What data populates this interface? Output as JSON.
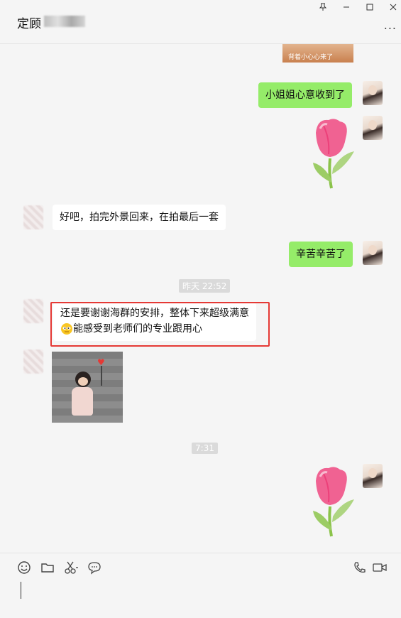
{
  "header": {
    "title": "定顾",
    "pin_icon": "pin-icon",
    "minimize_icon": "minimize-icon",
    "maximize_icon": "maximize-icon",
    "close_icon": "close-icon",
    "more_label": "..."
  },
  "messages": {
    "top_image_caption": "背着小心心来了",
    "msg1": "小姐姐心意收到了",
    "msg2": "好吧，拍完外景回来，在拍最后一套",
    "msg3": "辛苦辛苦了",
    "ts1": "昨天 22:52",
    "msg4_line1": "还是要谢谢海群的安排，整体下来超级满意",
    "msg4_line2": "能感受到老师们的专业跟用心",
    "ts2": "7:31"
  },
  "toolbar": {
    "icons": [
      "emoji-icon",
      "folder-icon",
      "scissors-icon",
      "chat-bubble-icon",
      "phone-icon",
      "video-icon"
    ]
  },
  "colors": {
    "my_bubble": "#95ec69",
    "other_bubble": "#ffffff",
    "highlight": "#e53935",
    "background": "#f5f5f5"
  }
}
